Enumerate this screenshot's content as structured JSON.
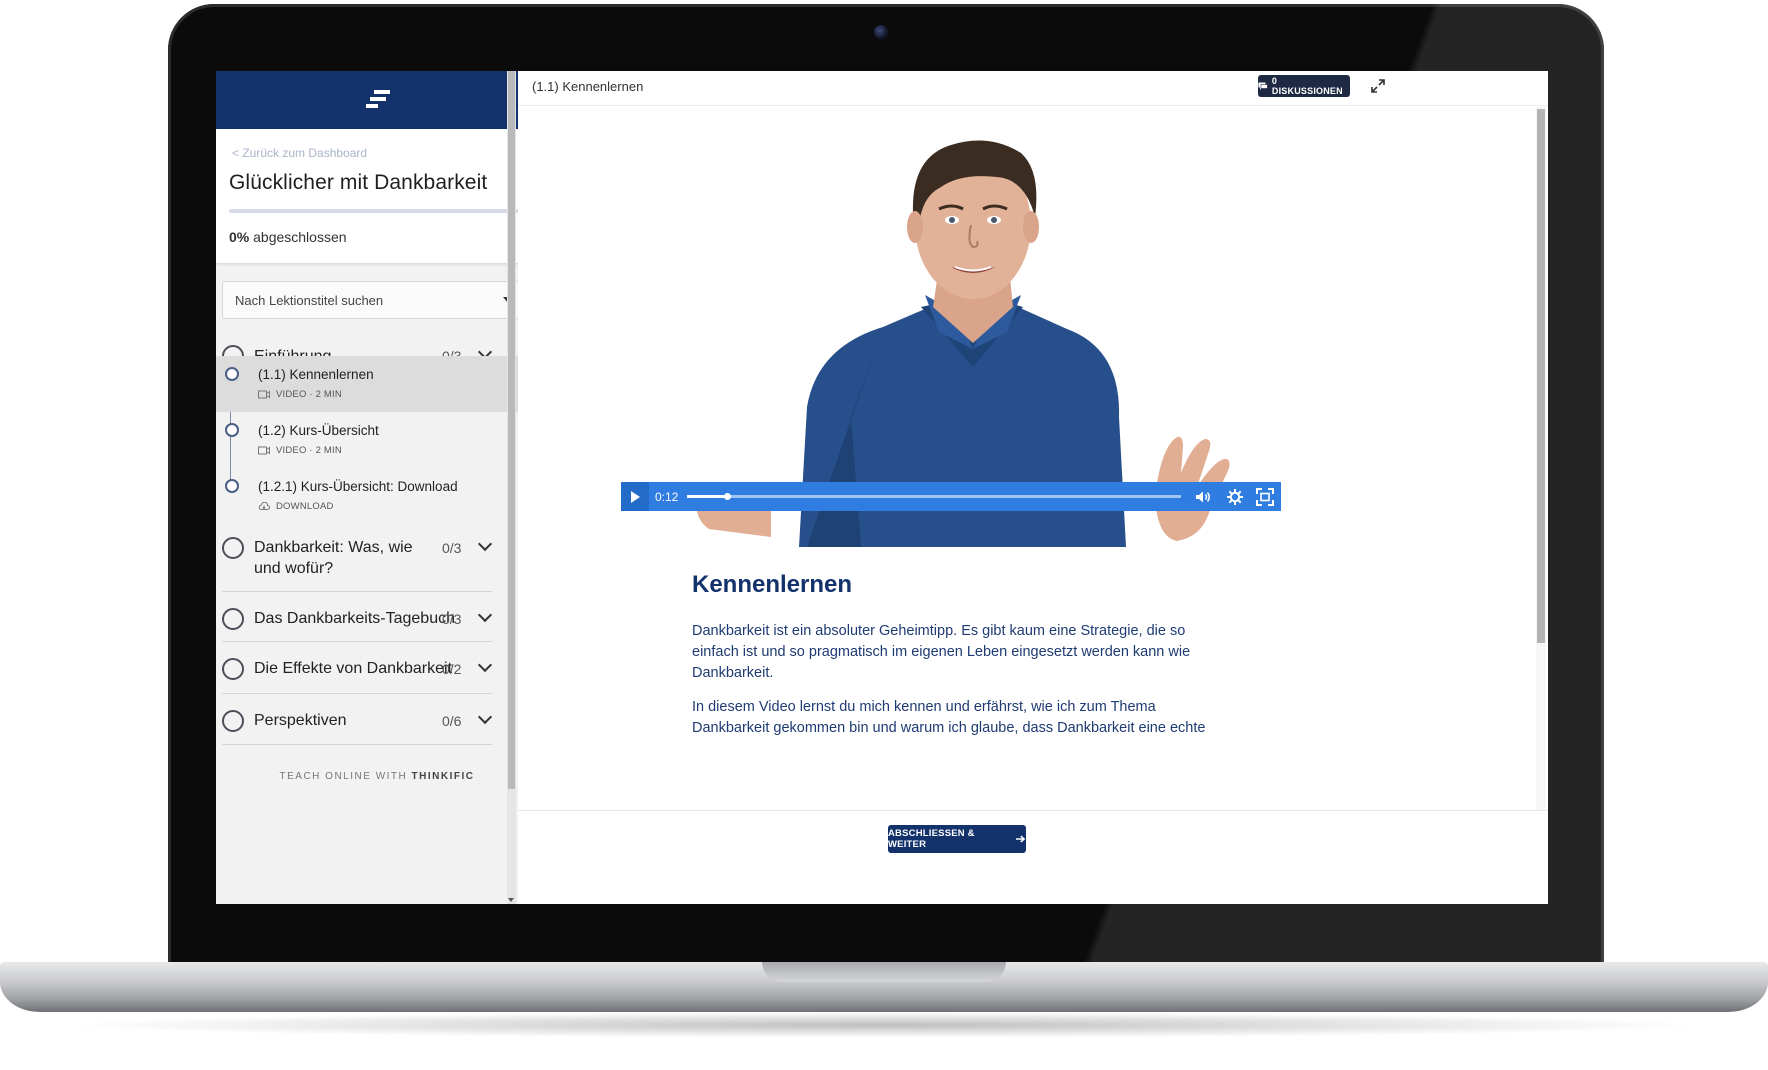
{
  "sidebar": {
    "back_link": "< Zurück zum Dashboard",
    "course_title": "Glücklicher mit Dankbarkeit",
    "progress": {
      "percent": "0%",
      "label": "abgeschlossen",
      "fraction": 0
    },
    "search_placeholder": "Nach Lektionstitel suchen",
    "chapters": [
      {
        "title": "Einführung",
        "count": "0/3",
        "expanded": true
      },
      {
        "title": "Dankbarkeit: Was, wie und wofür?",
        "count": "0/3",
        "expanded": false
      },
      {
        "title": "Das Dankbarkeits-Tagebuch",
        "count": "0/3",
        "expanded": false
      },
      {
        "title": "Die Effekte von Dankbarkeit",
        "count": "0/2",
        "expanded": false
      },
      {
        "title": "Perspektiven",
        "count": "0/6",
        "expanded": false
      }
    ],
    "lessons": [
      {
        "title": "(1.1) Kennenlernen",
        "meta": "VIDEO · 2 MIN",
        "type_icon": "video-icon",
        "active": true
      },
      {
        "title": "(1.2) Kurs-Übersicht",
        "meta": "VIDEO · 2 MIN",
        "type_icon": "video-icon",
        "active": false
      },
      {
        "title": "(1.2.1) Kurs-Übersicht: Download",
        "meta": "DOWNLOAD",
        "type_icon": "download-icon",
        "active": false
      }
    ],
    "footer_prefix": "TEACH ONLINE WITH",
    "footer_brand": "THINKIFIC"
  },
  "main": {
    "lesson_heading": "(1.1) Kennenlernen",
    "discussions_label": "0 DISKUSSIONEN",
    "video": {
      "time": "0:12",
      "progress_fraction": 0.08
    },
    "article_title": "Kennenlernen",
    "paragraphs": [
      "Dankbarkeit ist ein absoluter Geheimtipp. Es gibt kaum eine Strategie, die so einfach ist und so pragmatisch im eigenen Leben eingesetzt werden kann wie Dankbarkeit.",
      "In diesem Video lernst du mich kennen und erfährst, wie ich zum Thema Dankbarkeit gekommen bin und warum ich glaube, dass Dankbarkeit eine echte"
    ],
    "next_button": "ABSCHLIESSEN & WEITER"
  },
  "colors": {
    "brand_navy": "#13326b",
    "video_controls": "#2f7de1",
    "discussion_button": "#1e2a44"
  }
}
